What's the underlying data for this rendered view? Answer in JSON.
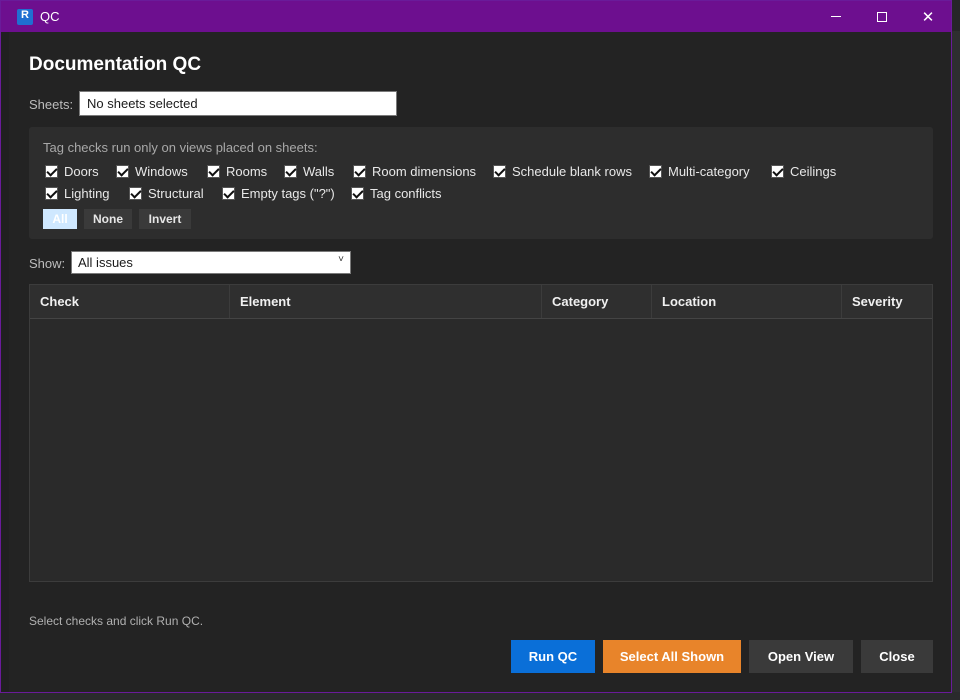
{
  "window": {
    "title": "QC",
    "controls": {
      "minimize": "minimize-icon",
      "maximize": "maximize-icon",
      "close": "close-icon"
    }
  },
  "heading": "Documentation QC",
  "sheets": {
    "label": "Sheets:",
    "value": "No sheets selected"
  },
  "tag_checks": {
    "caption": "Tag checks run only on views placed on sheets:",
    "items": [
      {
        "label": "Doors",
        "checked": true
      },
      {
        "label": "Windows",
        "checked": true
      },
      {
        "label": "Rooms",
        "checked": true
      },
      {
        "label": "Walls",
        "checked": true
      },
      {
        "label": "Room dimensions",
        "checked": true
      },
      {
        "label": "Schedule blank rows",
        "checked": true
      },
      {
        "label": "Multi-category",
        "checked": true
      },
      {
        "label": "Ceilings",
        "checked": true
      },
      {
        "label": "Lighting",
        "checked": true
      },
      {
        "label": "Structural",
        "checked": true
      },
      {
        "label": "Empty tags (\"?\")",
        "checked": true
      },
      {
        "label": "Tag conflicts",
        "checked": true
      }
    ],
    "buttons": {
      "all": "All",
      "none": "None",
      "invert": "Invert"
    }
  },
  "show": {
    "label": "Show:",
    "selected": "All issues"
  },
  "grid": {
    "columns": [
      "Check",
      "Element",
      "Category",
      "Location",
      "Severity"
    ],
    "rows": []
  },
  "status": "Select checks and click Run QC.",
  "actions": {
    "run": "Run QC",
    "select_all": "Select All Shown",
    "open_view": "Open View",
    "close": "Close"
  },
  "colors": {
    "titlebar": "#6d0f8f",
    "run_button": "#0a6fd8",
    "select_all_button": "#e8842a"
  }
}
